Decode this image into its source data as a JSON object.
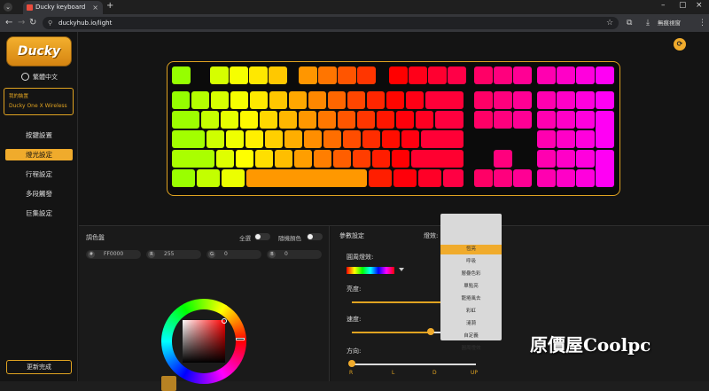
{
  "browser": {
    "tab_title": "Ducky keyboard",
    "url": "duckyhub.io/light",
    "profile_label": "無痕視窗"
  },
  "sidebar": {
    "logo_text": "Ducky",
    "language": "繁體中文",
    "device_label": "我的裝置",
    "device_name": "Ducky One X Wireless",
    "menu": [
      {
        "label": "按鍵設置",
        "active": false
      },
      {
        "label": "燈光設定",
        "active": true
      },
      {
        "label": "行程設定",
        "active": false
      },
      {
        "label": "多段觸發",
        "active": false
      },
      {
        "label": "巨集設定",
        "active": false
      }
    ],
    "update_button": "更新完成"
  },
  "color_panel": {
    "title": "調色盤",
    "select_all_label": "全選",
    "random_color_label": "隨機顏色",
    "fields": [
      {
        "key": "#",
        "value": "FF0000"
      },
      {
        "key": "R",
        "value": "255"
      },
      {
        "key": "G",
        "value": "0"
      },
      {
        "key": "B",
        "value": "0"
      }
    ],
    "swatch_color": "#b78223"
  },
  "param_panel": {
    "title": "參數設定",
    "effect_label": "燈效:",
    "effect_value": "彩虹",
    "circle_effect_label": "圓周燈效:",
    "brightness_label": "亮度:",
    "brightness": 1.0,
    "speed_label": "速度:",
    "speed": 0.6,
    "direction_label": "方向:",
    "direction": 0.0,
    "directions": [
      "R",
      "L",
      "D",
      "UP"
    ],
    "effects": [
      {
        "label": "恆亮",
        "selected": true
      },
      {
        "label": "呼吸",
        "selected": false
      },
      {
        "label": "層疊色彩",
        "selected": false
      },
      {
        "label": "單點亮",
        "selected": false
      },
      {
        "label": "龍捲風去",
        "selected": false
      },
      {
        "label": "彩虹",
        "selected": false
      },
      {
        "label": "漣漪",
        "selected": false
      },
      {
        "label": "自定義",
        "selected": false
      },
      {
        "label": "圓周燈效",
        "selected": false
      }
    ]
  },
  "watermark": "原價屋Coolpc",
  "colors": {
    "accent": "#f0ab2c",
    "background": "#151515"
  }
}
